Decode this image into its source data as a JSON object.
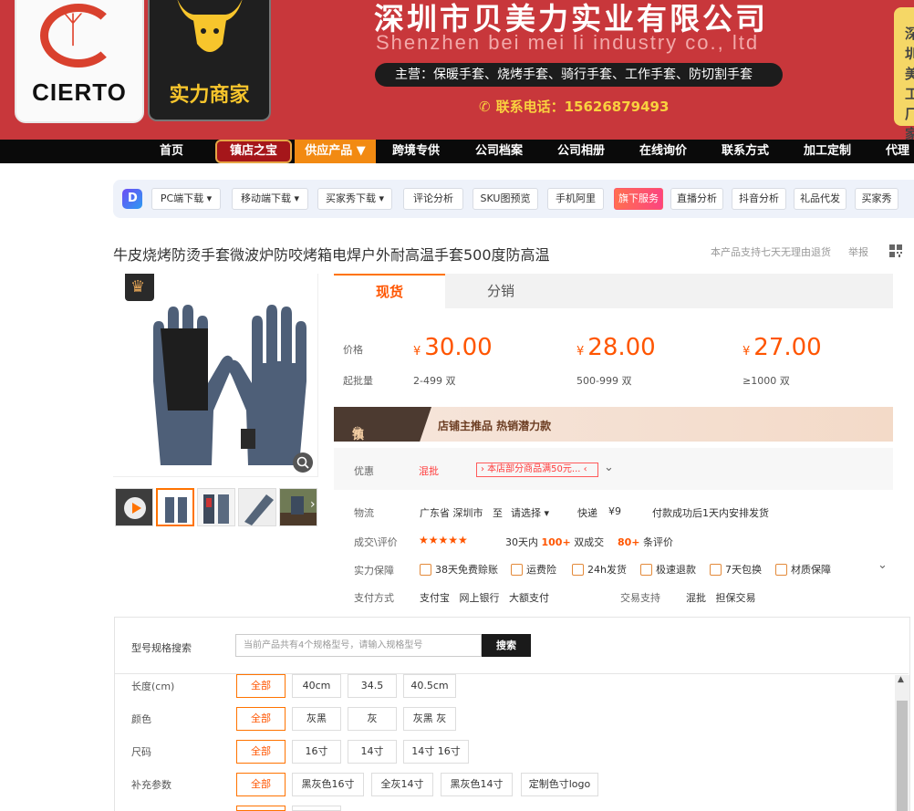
{
  "banner": {
    "logo_text": "CIERTO",
    "badge_text": "实力商家",
    "company_name": "深圳市贝美力实业有限公司",
    "company_en": "Shenzhen bei mei li industry co., ltd",
    "main_business": "主营：保暖手套、烧烤手套、骑行手套、工作手套、防切割手套",
    "hotline": "联系电话：15626879493",
    "side_tag": "深圳美工厂家"
  },
  "nav": {
    "home": "首页",
    "treasure": "镇店之宝",
    "products": "供应产品 ▼",
    "cross_border": "跨境专供",
    "archive": "公司档案",
    "album": "公司相册",
    "inquiry": "在线询价",
    "contact": "联系方式",
    "custom": "加工定制",
    "agent": "代理"
  },
  "toolbar": {
    "logo": "D",
    "pc_download": "PC端下载 ▾",
    "mobile_download": "移动端下载 ▾",
    "buyer_show_download": "买家秀下载 ▾",
    "review_analysis": "评论分析",
    "sku_preview": "SKU图预览",
    "mobile_ali": "手机阿里",
    "flagship_service": "旗下服务",
    "live_analysis": "直播分析",
    "douyin_analysis": "抖音分析",
    "gift_dropship": "礼品代发",
    "buyer_show": "买家秀"
  },
  "product": {
    "title": "牛皮烧烤防烫手套微波炉防咬烤箱电焊户外耐高温手套500度防高温",
    "guarantee": "本产品支持七天无理由退货",
    "report": "举报"
  },
  "tabs": {
    "spot": "现货",
    "distribution": "分销"
  },
  "price": {
    "price_label": "价格",
    "moq_label": "起批量",
    "currency": "¥",
    "tiers": [
      {
        "price": "30.00",
        "range": "2-499 双"
      },
      {
        "price": "28.00",
        "range": "500-999 双"
      },
      {
        "price": "27.00",
        "range": "≥1000 双"
      }
    ]
  },
  "treasure_banner": {
    "title": "镇店之宝",
    "text": "店铺主推品  热销潜力款"
  },
  "discount": {
    "label": "优惠",
    "type": "混批",
    "coupon": "› 本店部分商品满50元...",
    "coupon_end": "‹"
  },
  "logistics": {
    "label": "物流",
    "from": "广东省 深圳市",
    "to_word": "至",
    "to_select": "请选择 ▾",
    "express": "快递",
    "fee": "¥9",
    "ship_note": "付款成功后1天内安排发货"
  },
  "deals": {
    "label": "成交\\评价",
    "stars": "★★★★★",
    "sold_prefix": "30天内",
    "sold_count": "100+",
    "sold_suffix": "双成交",
    "review_count": "80+",
    "review_suffix": "条评价"
  },
  "services": {
    "label": "实力保障",
    "items": [
      "38天免费赊账",
      "运费险",
      "24h发货",
      "极速退款",
      "7天包换",
      "材质保障"
    ]
  },
  "payment": {
    "label": "支付方式",
    "methods": "支付宝   网上银行   大额支付",
    "trade_label": "交易支持",
    "trade_methods": "混批   担保交易"
  },
  "spec": {
    "search_label": "型号规格搜索",
    "search_placeholder": "当前产品共有4个规格型号，请输入规格型号",
    "search_button": "搜索",
    "groups": [
      {
        "label": "长度(cm)",
        "options": [
          "全部",
          "40cm",
          "34.5",
          "40.5cm"
        ]
      },
      {
        "label": "颜色",
        "options": [
          "全部",
          "灰黑",
          "灰",
          "灰黑 灰"
        ]
      },
      {
        "label": "尺码",
        "options": [
          "全部",
          "16寸",
          "14寸",
          "14寸 16寸"
        ]
      },
      {
        "label": "补充参数",
        "options": [
          "全部",
          "黑灰色16寸",
          "全灰14寸",
          "黑灰色14寸",
          "定制色寸logo"
        ]
      }
    ]
  },
  "colors": {
    "banner_red": "#c8373b",
    "accent_orange": "#ff5500",
    "nav_black": "#0a0a0a"
  }
}
